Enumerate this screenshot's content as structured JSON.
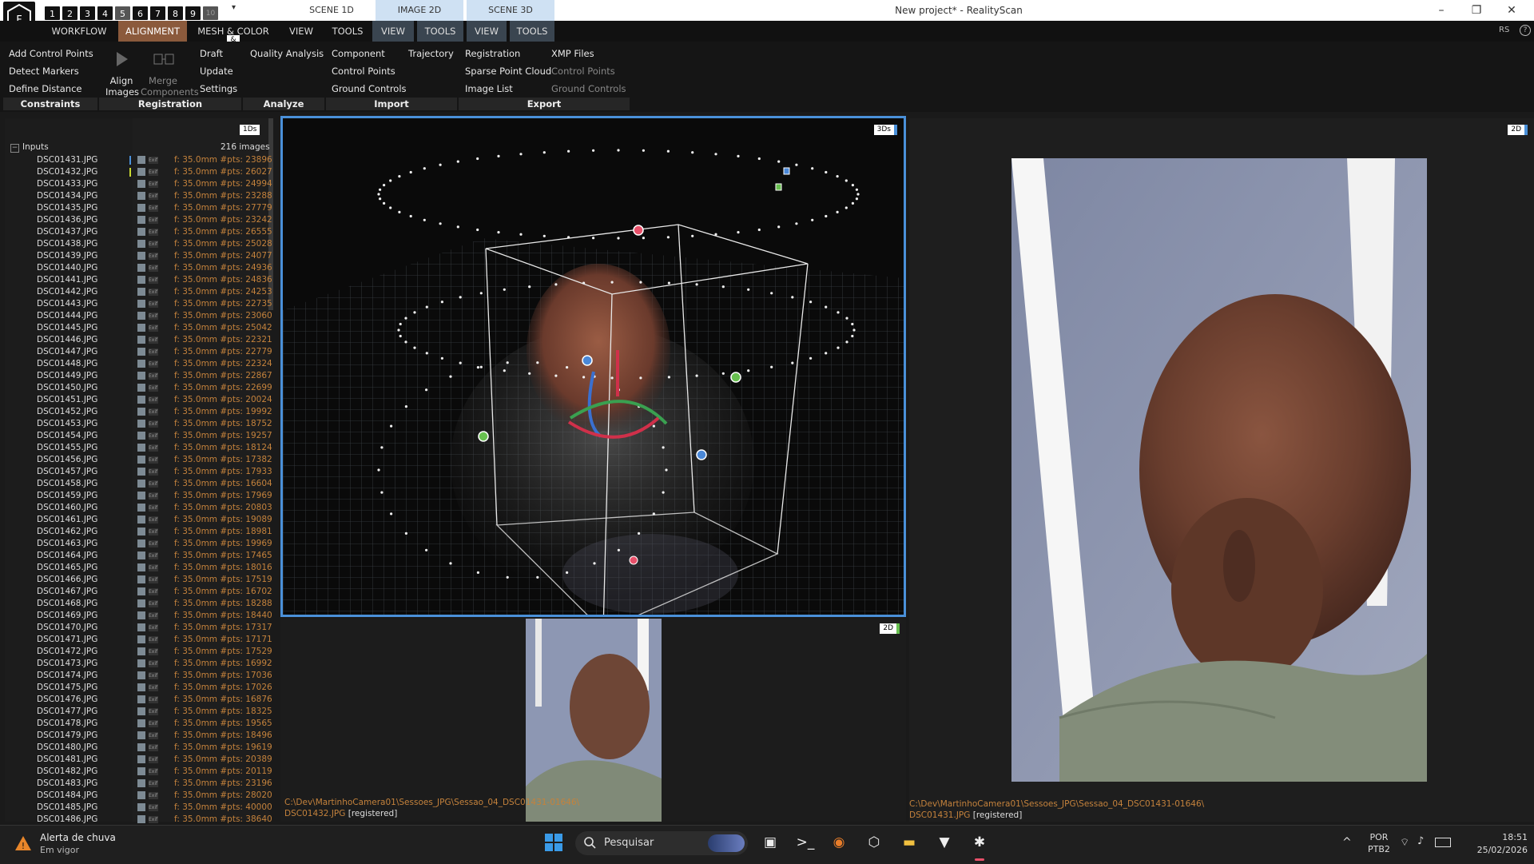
{
  "titlebar": {
    "layouts": [
      "1",
      "2",
      "3",
      "4",
      "5",
      "6",
      "7",
      "8",
      "9",
      "10"
    ],
    "qat": "▾",
    "tabs": [
      "SCENE 1D",
      "IMAGE 2D",
      "SCENE 3D"
    ],
    "title": "New project* - RealityScan",
    "controls": {
      "min": "–",
      "max": "❐",
      "close": "✕"
    }
  },
  "menu": {
    "items": [
      "WORKFLOW",
      "ALIGNMENT",
      "MESH & COLOR",
      "VIEW",
      "TOOLS",
      "VIEW",
      "TOOLS",
      "VIEW",
      "TOOLS"
    ],
    "amp_badge": "&",
    "right": "RS",
    "help": "?"
  },
  "ribbon": {
    "constraints": {
      "add_cp": "Add Control Points",
      "detect": "Detect Markers",
      "define": "Define Distance"
    },
    "registration": {
      "align": "Align",
      "images": "Images",
      "merge": "Merge",
      "components": "Components",
      "draft": "Draft",
      "update": "Update",
      "settings": "Settings"
    },
    "analyze": {
      "quality": "Quality Analysis"
    },
    "import": {
      "component": "Component",
      "trajectory": "Trajectory",
      "cp": "Control Points",
      "gc": "Ground Controls"
    },
    "export": {
      "registration": "Registration",
      "xmp": "XMP Files",
      "sparse": "Sparse Point Cloud",
      "cp": "Control Points",
      "imagelist": "Image List",
      "gc": "Ground Controls"
    },
    "groups": [
      "Constraints",
      "Registration",
      "Analyze",
      "Import",
      "Export"
    ]
  },
  "panel": {
    "tag": "1Ds",
    "inputs_label": "Inputs",
    "count": "216 images",
    "files": [
      [
        "DSC01431.JPG",
        "f: 35.0mm #pts: 23896"
      ],
      [
        "DSC01432.JPG",
        "f: 35.0mm #pts: 26027"
      ],
      [
        "DSC01433.JPG",
        "f: 35.0mm #pts: 24994"
      ],
      [
        "DSC01434.JPG",
        "f: 35.0mm #pts: 23288"
      ],
      [
        "DSC01435.JPG",
        "f: 35.0mm #pts: 27779"
      ],
      [
        "DSC01436.JPG",
        "f: 35.0mm #pts: 23242"
      ],
      [
        "DSC01437.JPG",
        "f: 35.0mm #pts: 26555"
      ],
      [
        "DSC01438.JPG",
        "f: 35.0mm #pts: 25028"
      ],
      [
        "DSC01439.JPG",
        "f: 35.0mm #pts: 24077"
      ],
      [
        "DSC01440.JPG",
        "f: 35.0mm #pts: 24936"
      ],
      [
        "DSC01441.JPG",
        "f: 35.0mm #pts: 24836"
      ],
      [
        "DSC01442.JPG",
        "f: 35.0mm #pts: 24253"
      ],
      [
        "DSC01443.JPG",
        "f: 35.0mm #pts: 22735"
      ],
      [
        "DSC01444.JPG",
        "f: 35.0mm #pts: 23060"
      ],
      [
        "DSC01445.JPG",
        "f: 35.0mm #pts: 25042"
      ],
      [
        "DSC01446.JPG",
        "f: 35.0mm #pts: 22321"
      ],
      [
        "DSC01447.JPG",
        "f: 35.0mm #pts: 22779"
      ],
      [
        "DSC01448.JPG",
        "f: 35.0mm #pts: 22324"
      ],
      [
        "DSC01449.JPG",
        "f: 35.0mm #pts: 22867"
      ],
      [
        "DSC01450.JPG",
        "f: 35.0mm #pts: 22699"
      ],
      [
        "DSC01451.JPG",
        "f: 35.0mm #pts: 20024"
      ],
      [
        "DSC01452.JPG",
        "f: 35.0mm #pts: 19992"
      ],
      [
        "DSC01453.JPG",
        "f: 35.0mm #pts: 18752"
      ],
      [
        "DSC01454.JPG",
        "f: 35.0mm #pts: 19257"
      ],
      [
        "DSC01455.JPG",
        "f: 35.0mm #pts: 18124"
      ],
      [
        "DSC01456.JPG",
        "f: 35.0mm #pts: 17382"
      ],
      [
        "DSC01457.JPG",
        "f: 35.0mm #pts: 17933"
      ],
      [
        "DSC01458.JPG",
        "f: 35.0mm #pts: 16604"
      ],
      [
        "DSC01459.JPG",
        "f: 35.0mm #pts: 17969"
      ],
      [
        "DSC01460.JPG",
        "f: 35.0mm #pts: 20803"
      ],
      [
        "DSC01461.JPG",
        "f: 35.0mm #pts: 19089"
      ],
      [
        "DSC01462.JPG",
        "f: 35.0mm #pts: 18981"
      ],
      [
        "DSC01463.JPG",
        "f: 35.0mm #pts: 19969"
      ],
      [
        "DSC01464.JPG",
        "f: 35.0mm #pts: 17465"
      ],
      [
        "DSC01465.JPG",
        "f: 35.0mm #pts: 18016"
      ],
      [
        "DSC01466.JPG",
        "f: 35.0mm #pts: 17519"
      ],
      [
        "DSC01467.JPG",
        "f: 35.0mm #pts: 16702"
      ],
      [
        "DSC01468.JPG",
        "f: 35.0mm #pts: 18288"
      ],
      [
        "DSC01469.JPG",
        "f: 35.0mm #pts: 18440"
      ],
      [
        "DSC01470.JPG",
        "f: 35.0mm #pts: 17317"
      ],
      [
        "DSC01471.JPG",
        "f: 35.0mm #pts: 17171"
      ],
      [
        "DSC01472.JPG",
        "f: 35.0mm #pts: 17529"
      ],
      [
        "DSC01473.JPG",
        "f: 35.0mm #pts: 16992"
      ],
      [
        "DSC01474.JPG",
        "f: 35.0mm #pts: 17036"
      ],
      [
        "DSC01475.JPG",
        "f: 35.0mm #pts: 17026"
      ],
      [
        "DSC01476.JPG",
        "f: 35.0mm #pts: 16876"
      ],
      [
        "DSC01477.JPG",
        "f: 35.0mm #pts: 18325"
      ],
      [
        "DSC01478.JPG",
        "f: 35.0mm #pts: 19565"
      ],
      [
        "DSC01479.JPG",
        "f: 35.0mm #pts: 18496"
      ],
      [
        "DSC01480.JPG",
        "f: 35.0mm #pts: 19619"
      ],
      [
        "DSC01481.JPG",
        "f: 35.0mm #pts: 20389"
      ],
      [
        "DSC01482.JPG",
        "f: 35.0mm #pts: 20119"
      ],
      [
        "DSC01483.JPG",
        "f: 35.0mm #pts: 23196"
      ],
      [
        "DSC01484.JPG",
        "f: 35.0mm #pts: 28020"
      ],
      [
        "DSC01485.JPG",
        "f: 35.0mm #pts: 40000"
      ],
      [
        "DSC01486.JPG",
        "f: 35.0mm #pts: 38640"
      ]
    ]
  },
  "viewports": {
    "v3d_tag": "3Ds",
    "v2d_tag": "2D",
    "small_path": "C:\\Dev\\MartinhoCamera01\\Sessoes_JPG\\Sessao_04_DSC01431-01646\\",
    "small_file": "DSC01432.JPG",
    "small_status": "[registered]",
    "big_tag": "2D",
    "big_path": "C:\\Dev\\MartinhoCamera01\\Sessoes_JPG\\Sessao_04_DSC01431-01646\\",
    "big_file": "DSC01431.JPG",
    "big_status": "[registered]"
  },
  "taskbar": {
    "weather_title": "Alerta de chuva",
    "weather_sub": "Em vigor",
    "search": "Pesquisar",
    "lang1": "POR",
    "lang2": "PTB2",
    "time": "18:51",
    "date": "25/02/2026"
  },
  "colors": {
    "accent": "#4a90d9",
    "menu_active": "#8b5a3c",
    "info": "#c4823c"
  }
}
